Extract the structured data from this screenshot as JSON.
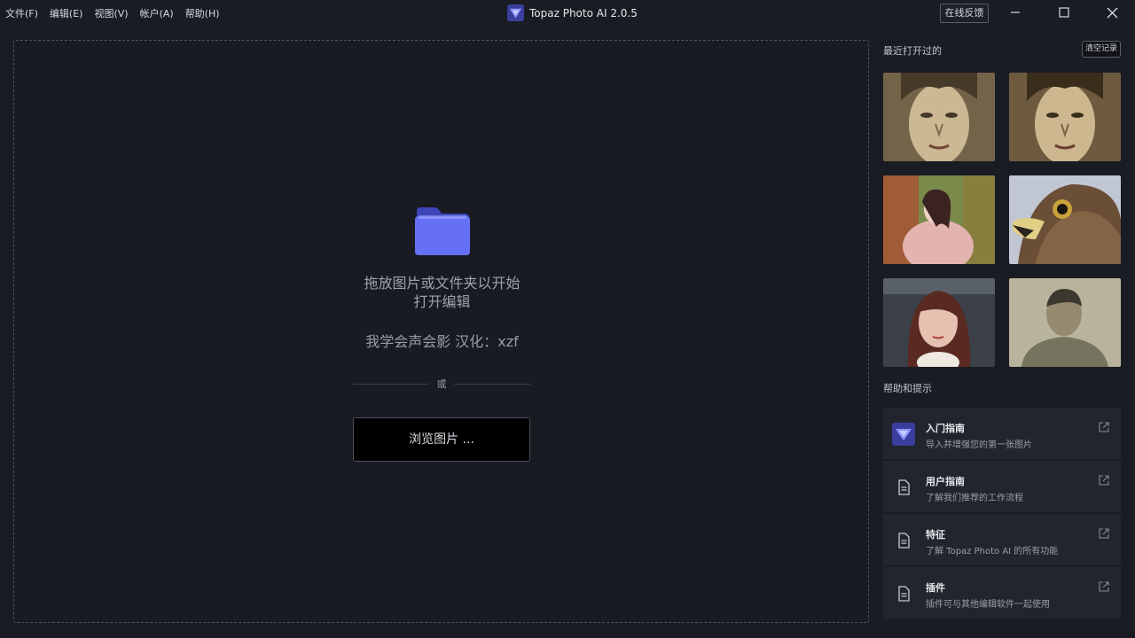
{
  "menu": {
    "items": [
      {
        "label": "文件(F)"
      },
      {
        "label": "编辑(E)"
      },
      {
        "label": "视图(V)"
      },
      {
        "label": "帐户(A)"
      },
      {
        "label": "帮助(H)"
      }
    ]
  },
  "app": {
    "title": "Topaz Photo AI 2.0.5",
    "feedback_label": "在线反馈"
  },
  "dropzone": {
    "line1": "拖放图片或文件夹以开始",
    "line2": "打开编辑",
    "credit": "我学会声会影   汉化：xzf",
    "or_label": "或",
    "browse_label": "浏览图片 ..."
  },
  "recent": {
    "title": "最近打开过的",
    "clear_label": "清空记录"
  },
  "help": {
    "title": "帮助和提示",
    "cards": [
      {
        "title": "入门指南",
        "subtitle": "导入并增强您的第一张图片",
        "icon": "topaz-logo-icon"
      },
      {
        "title": "用户指南",
        "subtitle": "了解我们推荐的工作流程",
        "icon": "document-icon"
      },
      {
        "title": "特征",
        "subtitle": "了解 Topaz Photo AI 的所有功能",
        "icon": "document-icon"
      },
      {
        "title": "插件",
        "subtitle": "插件可与其他编辑软件一起使用",
        "icon": "document-icon"
      }
    ]
  },
  "colors": {
    "background": "#1a1c24",
    "card": "#22252e",
    "accent": "#5b63f0"
  }
}
